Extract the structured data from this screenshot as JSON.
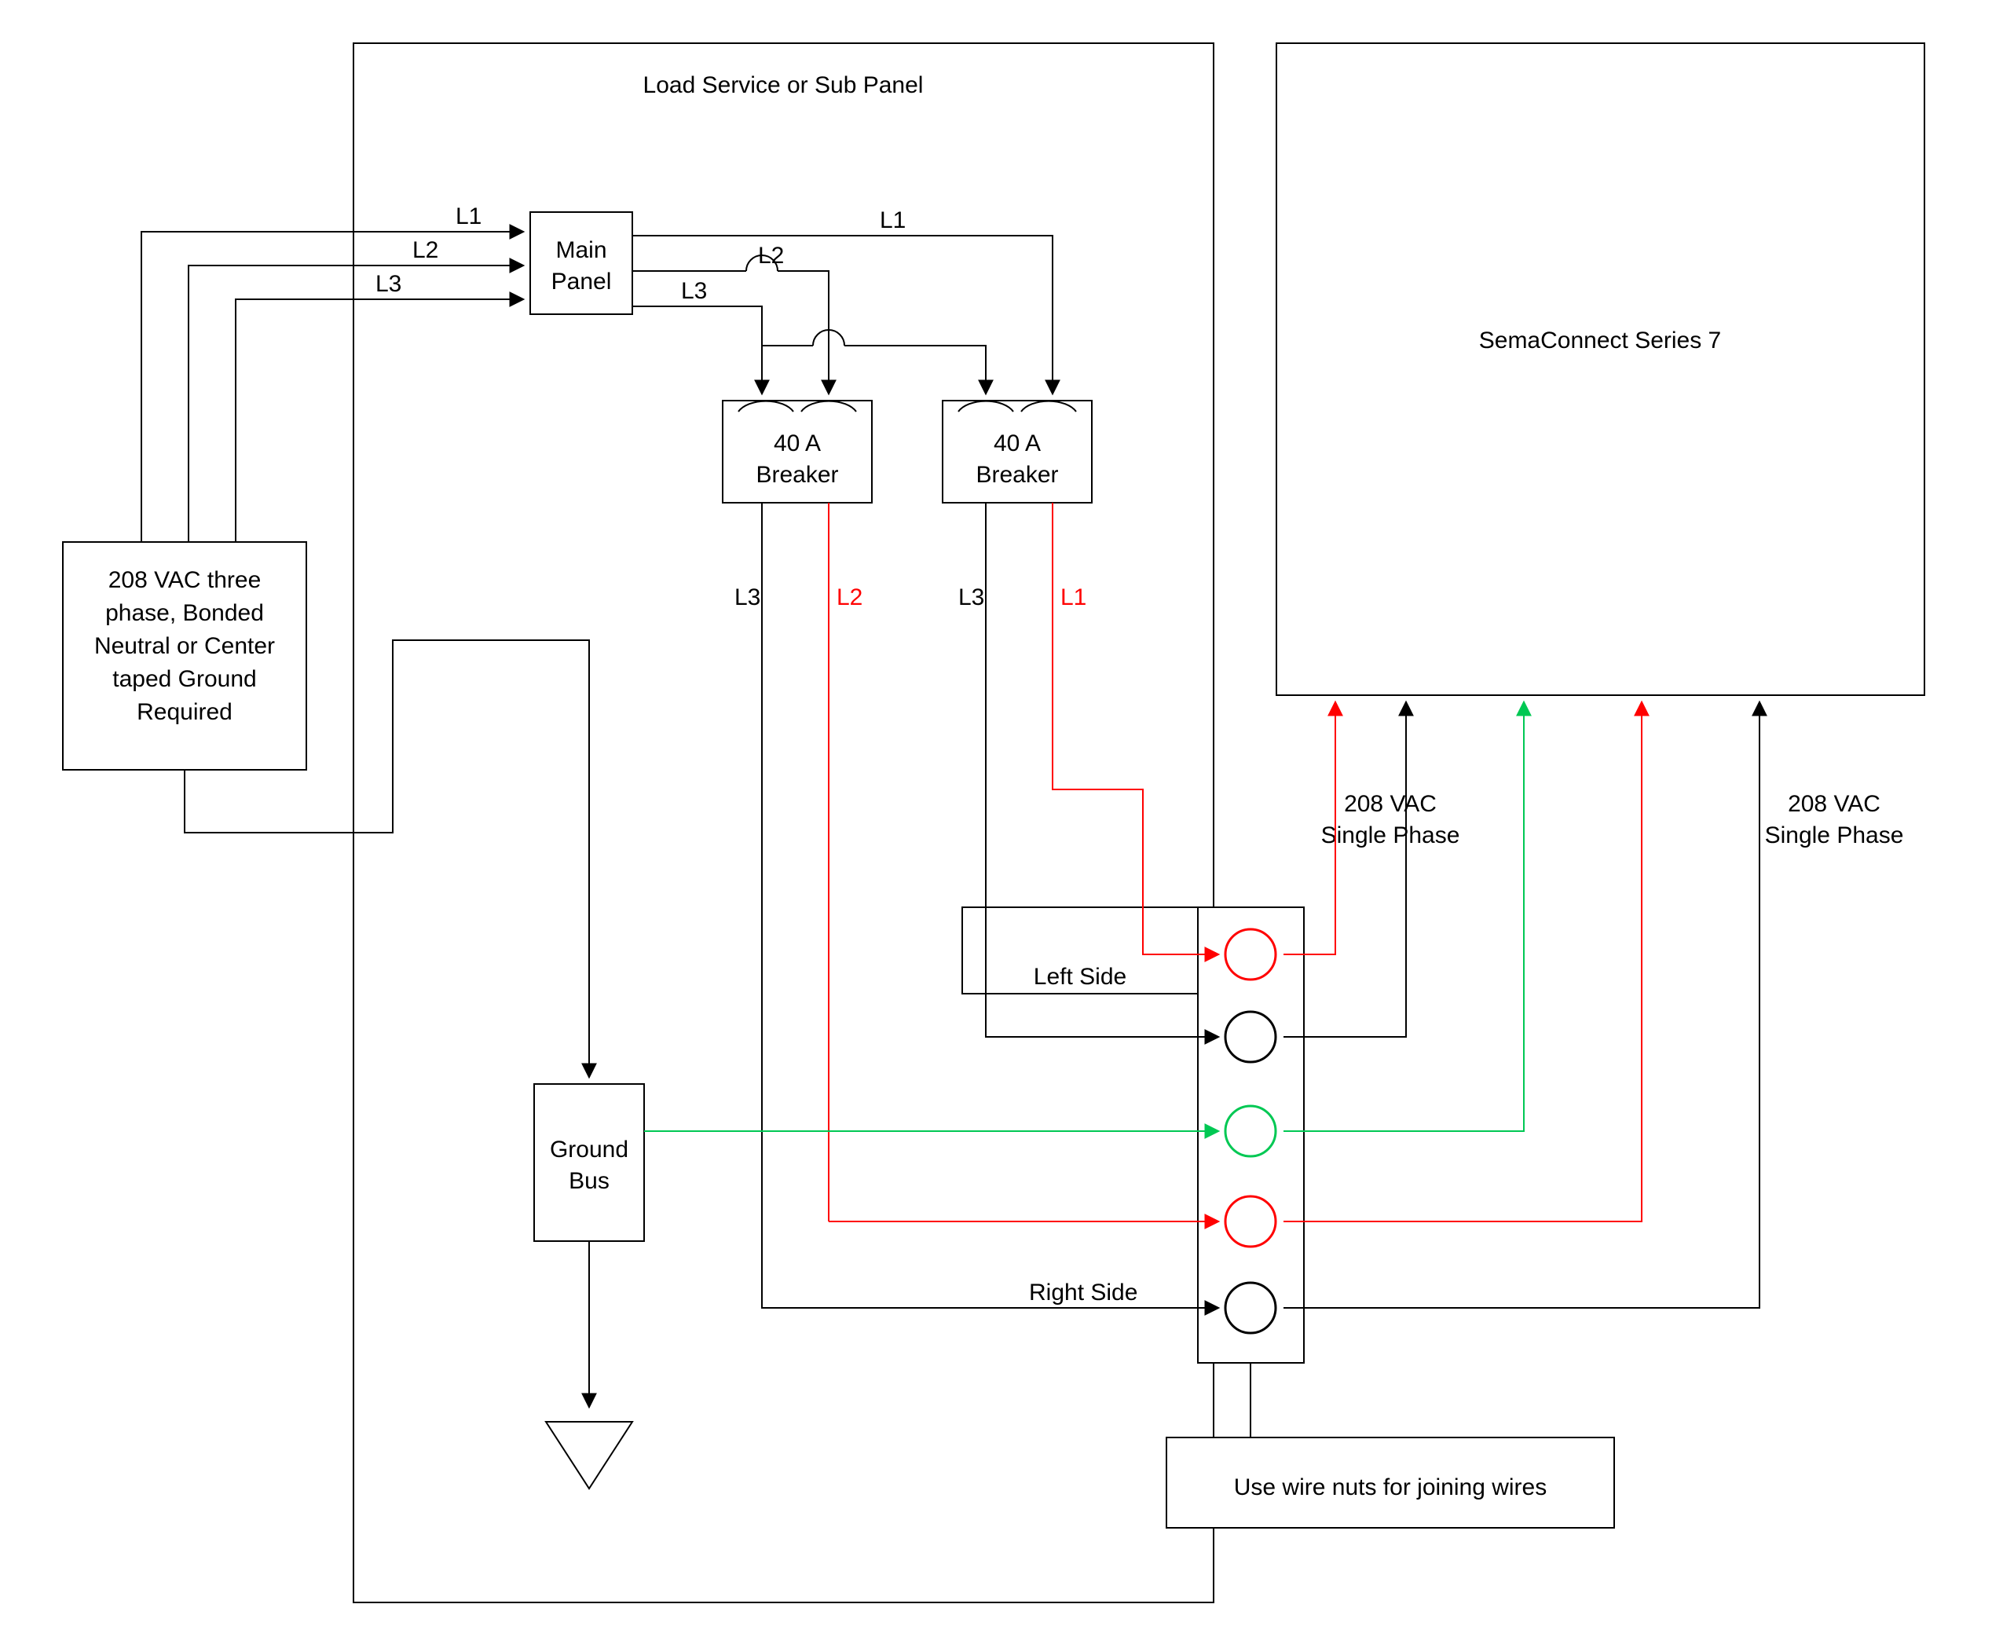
{
  "panel_title": "Load Service or Sub Panel",
  "source_box": [
    "208 VAC three",
    "phase, Bonded",
    "Neutral or Center",
    "taped Ground",
    "Required"
  ],
  "main_panel": [
    "Main",
    "Panel"
  ],
  "breaker": [
    "40 A",
    "Breaker"
  ],
  "breaker2": [
    "40 A",
    "Breaker"
  ],
  "ground_bus": [
    "Ground",
    "Bus"
  ],
  "sema": "SemaConnect Series 7",
  "left_side": "Left Side",
  "right_side": "Right Side",
  "vac_single": [
    "208 VAC",
    "Single Phase"
  ],
  "vac_single2": [
    "208 VAC",
    "Single Phase"
  ],
  "wire_label": {
    "L1_a": "L1",
    "L1_b": "L1",
    "L1_c": "L1",
    "L2_a": "L2",
    "L2_b": "L2",
    "L2_c": "L2",
    "L3_a": "L3",
    "L3_b": "L3",
    "L3_c": "L3",
    "L3_d": "L3"
  },
  "wire_nuts": "Use wire nuts for joining wires",
  "colors": {
    "black": "#000000",
    "red": "#ff0000",
    "green": "#00c853"
  }
}
